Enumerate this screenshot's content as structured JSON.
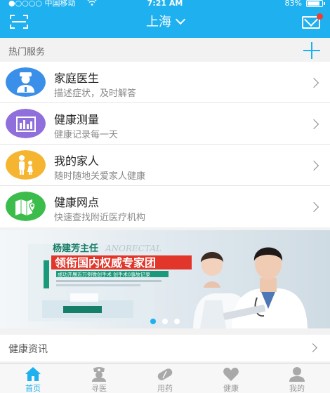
{
  "status_bar": {
    "carrier": "●○○○○ 中国移动",
    "time": "7:21 AM",
    "battery": "83%"
  },
  "header": {
    "city": "上海"
  },
  "hot_services": {
    "title": "热门服务"
  },
  "services": [
    {
      "name": "家庭医生",
      "desc": "描述症状，及时解答",
      "icon": "doctor-icon",
      "color": "#3a8fe8"
    },
    {
      "name": "健康测量",
      "desc": "健康记录每一天",
      "icon": "chart-icon",
      "color": "#8f6fdc"
    },
    {
      "name": "我的家人",
      "desc": "随时随地关爱家人健康",
      "icon": "family-icon",
      "color": "#f5b531"
    },
    {
      "name": "健康网点",
      "desc": "快速查找附近医疗机构",
      "icon": "map-pin-icon",
      "color": "#3cbc4b"
    }
  ],
  "banner": {
    "doctor_name": "杨建芳主任",
    "latin_text": "ANORECTAL",
    "headline": "领衔国内权威专家团",
    "subline": "成功开展近万例微创手术 创手术0事故记录",
    "page_count": 3,
    "active_page": 0
  },
  "news": {
    "title": "健康资讯"
  },
  "tabs": [
    {
      "label": "首页",
      "icon": "home-icon",
      "active": true
    },
    {
      "label": "寻医",
      "icon": "nurse-icon",
      "active": false
    },
    {
      "label": "用药",
      "icon": "pill-icon",
      "active": false
    },
    {
      "label": "健康",
      "icon": "heart-icon",
      "active": false
    },
    {
      "label": "我的",
      "icon": "person-icon",
      "active": false
    }
  ],
  "colors": {
    "primary": "#1eb0ef",
    "badge": "#f03c32"
  }
}
